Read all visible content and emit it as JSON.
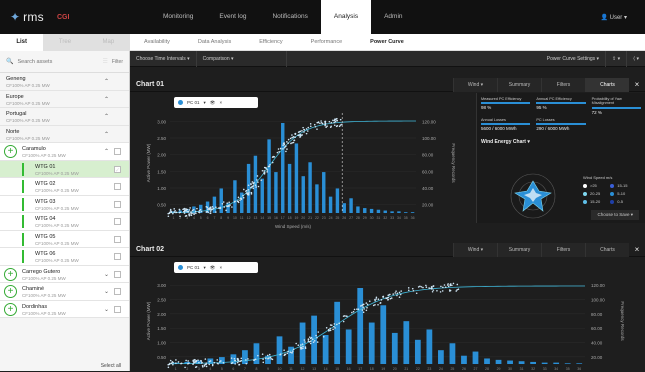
{
  "app": {
    "logo": "rms",
    "sub": "CGI",
    "user": "User"
  },
  "nav": [
    "Monitoring",
    "Event log",
    "Notifications",
    "Analysis",
    "Admin"
  ],
  "subnav": [
    "Availability",
    "Data Analysis",
    "Efficiency",
    "Performance",
    "Power Curve"
  ],
  "left_tabs": [
    "List",
    "Tree",
    "Map"
  ],
  "search": {
    "placeholder": "Search assets",
    "filter": "Filter"
  },
  "tree": [
    {
      "kind": "region",
      "name": "Geneng",
      "meta": "CF100%   AP 0.25 MW"
    },
    {
      "kind": "region",
      "name": "Europe",
      "meta": "CF100%   AP 0.25 MW"
    },
    {
      "kind": "region",
      "name": "Portugal",
      "meta": "CF100%   AP 0.25 MW"
    },
    {
      "kind": "region",
      "name": "Norte",
      "meta": "CF100%   AP 0.25 MW"
    },
    {
      "kind": "farm",
      "name": "Caramulo",
      "meta": "CF100%   AP 0.25 MW"
    },
    {
      "kind": "wtg",
      "name": "WTG 01",
      "meta": "CF100%   AP 0.25 MW",
      "sel": true
    },
    {
      "kind": "wtg",
      "name": "WTG 02",
      "meta": "CF100%   AP 0.25 MW"
    },
    {
      "kind": "wtg",
      "name": "WTG 03",
      "meta": "CF100%   AP 0.25 MW"
    },
    {
      "kind": "wtg",
      "name": "WTG 04",
      "meta": "CF100%   AP 0.25 MW"
    },
    {
      "kind": "wtg",
      "name": "WTG 05",
      "meta": "CF100%   AP 0.25 MW"
    },
    {
      "kind": "wtg",
      "name": "WTG 06",
      "meta": "CF100%   AP 0.25 MW"
    },
    {
      "kind": "farm",
      "name": "Carrego Gutero",
      "meta": "CF100%   AP 0.25 MW"
    },
    {
      "kind": "farm",
      "name": "Chaminé",
      "meta": "CF100%   AP 0.25 MW"
    },
    {
      "kind": "farm",
      "name": "Dordinhas",
      "meta": "CF100%   AP 0.25 MW"
    }
  ],
  "select_all": "Select all",
  "controls": {
    "time": "Choose Time Intervals",
    "compare": "Comparison",
    "settings": "Power Curve Settings"
  },
  "panels": [
    {
      "title": "Chart 01",
      "wind": "Wind",
      "tabs": [
        "Summary",
        "Filters",
        "Charts"
      ],
      "badge": "PC 01"
    },
    {
      "title": "Chart 02",
      "wind": "Wind",
      "tabs": [
        "Summary",
        "Filters",
        "Charts"
      ],
      "badge": "PC 01"
    }
  ],
  "summary": {
    "kpis": [
      {
        "label": "Measured PC Efficiency",
        "value": "98 %"
      },
      {
        "label": "Annual PC Efficiency",
        "value": "95 %"
      },
      {
        "label": "Probability of Yaw Misalignment",
        "value": "72 %"
      },
      {
        "label": "Annual Losses",
        "value": "5600 / 6000 MWh"
      },
      {
        "label": "PC Losses",
        "value": "290 / 6000 MWh"
      }
    ],
    "wind_chart": "Wind Energy Chart",
    "legend_title": "Wind Speed m/s",
    "legend": [
      {
        "label": ">25",
        "color": "#ffffff"
      },
      {
        "label": "15-15",
        "color": "#3a5fd9"
      },
      {
        "label": "20-25",
        "color": "#7fd8f0"
      },
      {
        "label": "5-10",
        "color": "#2a8fd6"
      },
      {
        "label": "15-20",
        "color": "#5fbfe8"
      },
      {
        "label": "0-5",
        "color": "#1f3fa8"
      }
    ],
    "choose": "Choose to Save"
  },
  "chart_data": [
    {
      "type": "bar",
      "title": "Chart 01",
      "xlabel": "Wind Speed (m/s)",
      "ylabel": "Active Power (MW)",
      "y2label": "Frequency Records",
      "yticks": [
        "3.00",
        "2.50",
        "2.00",
        "1.50",
        "1.00",
        "0.50"
      ],
      "y2ticks": [
        "120.00",
        "100.00",
        "80.00",
        "60.00",
        "40.00",
        "20.00"
      ],
      "bars": [
        2,
        3,
        5,
        8,
        10,
        14,
        20,
        30,
        12,
        40,
        25,
        60,
        70,
        42,
        90,
        50,
        110,
        60,
        85,
        45,
        62,
        35,
        50,
        20,
        30,
        12,
        18,
        8,
        6,
        5,
        4,
        3,
        2,
        2,
        1,
        1
      ],
      "curve_max": 2.6
    },
    {
      "type": "bar",
      "title": "Chart 02",
      "xlabel": "",
      "ylabel": "Active Power (MW)",
      "y2label": "Frequency Records",
      "yticks": [
        "3.00",
        "2.50",
        "2.00",
        "1.50",
        "1.00",
        "0.50"
      ],
      "y2ticks": [
        "120.00",
        "100.00",
        "80.00",
        "60.00",
        "40.00",
        "20.00"
      ],
      "bars": [
        2,
        3,
        5,
        8,
        10,
        14,
        20,
        30,
        12,
        40,
        25,
        60,
        70,
        42,
        90,
        50,
        110,
        60,
        85,
        45,
        62,
        35,
        50,
        20,
        30,
        12,
        18,
        8,
        6,
        5,
        4,
        3,
        2,
        2,
        1,
        1
      ],
      "curve_max": 2.6
    }
  ]
}
